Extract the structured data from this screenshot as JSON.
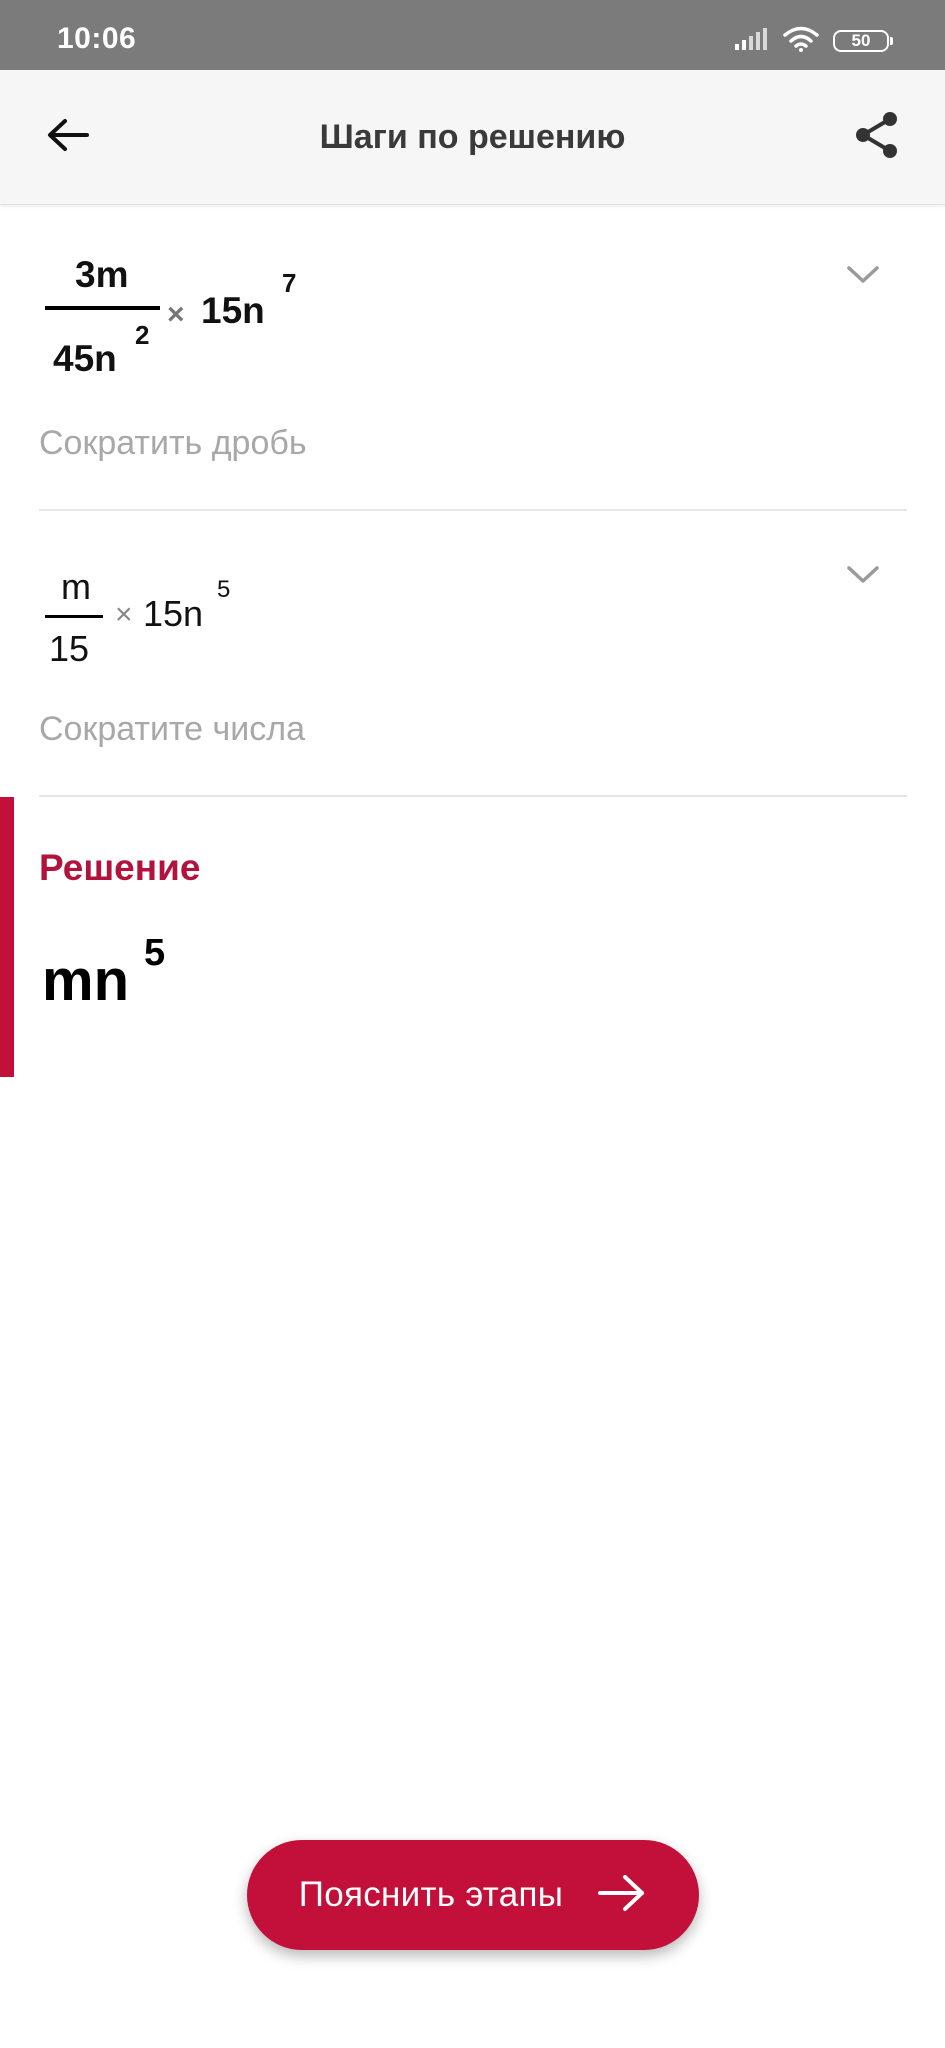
{
  "status_bar": {
    "time": "10:06",
    "battery": "50",
    "icons": [
      "signal-icon",
      "wifi-icon",
      "battery-icon"
    ]
  },
  "app_bar": {
    "title": "Шаги по решению",
    "back_icon": "arrow-left-icon",
    "share_icon": "share-icon"
  },
  "steps": [
    {
      "expression": {
        "numerator": "3m",
        "denominator_base": "45n",
        "denominator_exp": "2",
        "operator": "×",
        "factor_base": "15n",
        "factor_exp": "7"
      },
      "description": "Сократить дробь",
      "toggle_icon": "chevron-down-icon"
    },
    {
      "expression": {
        "numerator": "m",
        "denominator": "15",
        "operator": "×",
        "factor_base": "15n",
        "factor_exp": "5"
      },
      "description": "Сократите числа",
      "toggle_icon": "chevron-down-icon"
    }
  ],
  "solution": {
    "title": "Решение",
    "value_base": "mn",
    "value_exp": "5"
  },
  "explain_button": {
    "label": "Пояснить этапы",
    "icon": "arrow-right-icon"
  },
  "colors": {
    "accent": "#c2103a",
    "status_bar": "#7b7b7b",
    "app_bar": "#f6f6f6",
    "muted_text": "#a8a8a8"
  }
}
